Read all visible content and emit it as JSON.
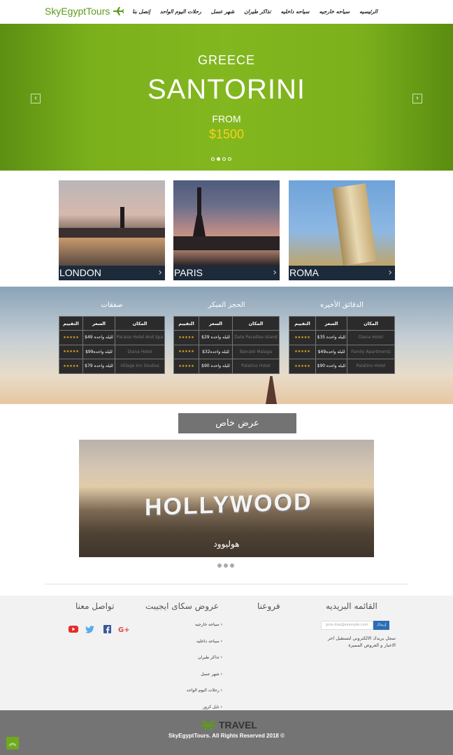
{
  "nav": {
    "logo": "SkyEgyptTours",
    "links": [
      "الرئيسيه",
      "سياحه خارجيه",
      "سياحه داخليه",
      "تذاكر طيران",
      "شهر عسل",
      "رحلات اليوم الواحد",
      "إتصل بنا"
    ]
  },
  "hero": {
    "subtitle": "GREECE",
    "title": "SANTORINI",
    "from": "FROM",
    "price": "$1500",
    "prev_label": "‹",
    "next_label": "›",
    "active_slide": 2,
    "slide_count": 4
  },
  "cities": [
    {
      "name": "LONDON"
    },
    {
      "name": "PARIS"
    },
    {
      "name": "ROMA"
    }
  ],
  "deals": [
    {
      "title": "الدقائق الأخيره",
      "headers": [
        "المكان",
        "السعر",
        "التقييم"
      ],
      "rows": [
        {
          "place": "Diana Hotel",
          "price": "$35 لليله واحده",
          "stars": "★★★★★"
        },
        {
          "place": "Family Apartments",
          "price": "$49لليله واحده",
          "stars": "★★★★★"
        },
        {
          "place": "Palatino Hotel",
          "price": "$90 لليله واحده",
          "stars": "★★★★★"
        }
      ]
    },
    {
      "title": "الحجز المبكر",
      "headers": [
        "المكان",
        "السعر",
        "التقييم"
      ],
      "rows": [
        {
          "place": "Date Paradise Island",
          "price": "$29 لليله واحده",
          "stars": "★★★★★"
        },
        {
          "place": "Barceló Malaga",
          "price": "$32لليله واحده",
          "stars": "★★★★★"
        },
        {
          "place": "Palatino Hotel",
          "price": "$90 لليله واحده",
          "stars": "★★★★★"
        }
      ]
    },
    {
      "title": "صفقات",
      "headers": [
        "المكان",
        "السعر",
        "التقييم"
      ],
      "rows": [
        {
          "place": "Paraiso Hotel And Spa",
          "price": "$49 لليله واحده",
          "stars": "★★★★★"
        },
        {
          "place": "Diana Hotel",
          "price": "$99لليله واحده",
          "stars": "★★★★★"
        },
        {
          "place": "Village Inn Studios",
          "price": "$79 لليله واحده",
          "stars": "★★★★★"
        }
      ]
    }
  ],
  "special": {
    "heading": "عرض خاص",
    "sign": "HOLLYWOOD",
    "caption": "هوليوود",
    "slide_count": 3
  },
  "footer": {
    "newsletter_title": "القائمه البريديه",
    "newsletter_placeholder": "jane.doe@example.com",
    "newsletter_button": "إرسال",
    "newsletter_text": "سجل بريدك الالكتروني لتستقبل اخر الاخبار و العروض المميزة",
    "branches_title": "فروعنا",
    "offers_title": "عروض سكاى ايجيبت",
    "offer_links": [
      "سياحه خارجيه",
      "سياحه داخليه",
      "تذاكر طيران",
      "شهر عسل",
      "رحلات اليوم الواحد",
      "نايل كروز"
    ],
    "contact_title": "تواصل معنا",
    "social": [
      "youtube-icon",
      "twitter-icon",
      "facebook-icon",
      "google-plus-icon"
    ]
  },
  "bottom": {
    "logo_text": "TRAVEL",
    "copyright": "SkyEgyptTours. All Rights Reserved 2018 ©",
    "totop": "︽"
  },
  "colors": {
    "brand_green": "#7bb01c",
    "price_yellow": "#f3d21a",
    "footer_gray": "#747474"
  }
}
